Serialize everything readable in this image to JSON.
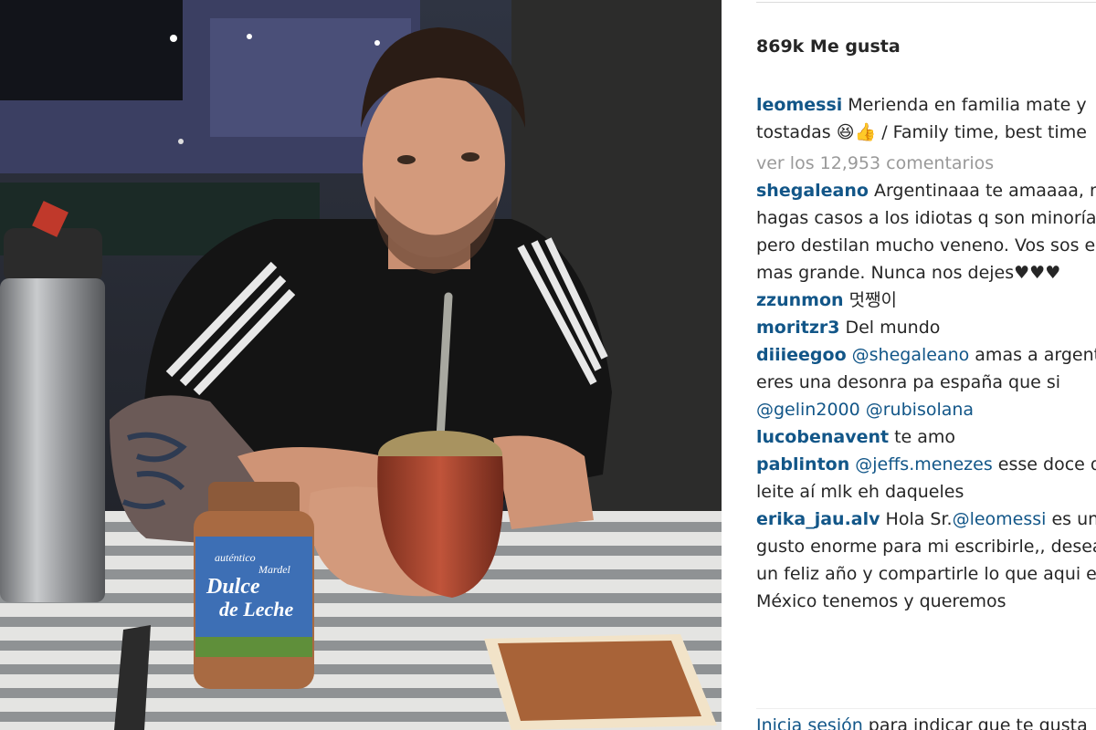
{
  "post": {
    "photo_alt": "Man at a table with a mate gourd, a thermos, a jar and toast",
    "jar": {
      "line1": "auténtico",
      "brand": "Mardel",
      "line2": "Dulce",
      "line3": "de Leche"
    },
    "likes": "869k Me gusta",
    "caption": {
      "user": "leomessi",
      "text": "Merienda en familia mate y tostadas 😆👍 / Family time, best time"
    },
    "view_all": "ver los 12,953 comentarios",
    "comments": [
      {
        "user": "shegaleano",
        "parts": [
          {
            "text": "Argentinaaa te amaaaa, no le hagas casos a los idiotas q son minoría pero destilan mucho veneno. Vos sos el mas grande. Nunca nos dejes♥♥♥"
          }
        ]
      },
      {
        "user": "zzunmon",
        "parts": [
          {
            "text": "멋쨍이"
          }
        ]
      },
      {
        "user": "moritzr3",
        "parts": [
          {
            "text": "Del mundo"
          }
        ]
      },
      {
        "user": "diiieegoo",
        "parts": [
          {
            "text": "@shegaleano",
            "mention": true
          },
          {
            "text": " amas a argentina eres una desonra pa españa que si "
          },
          {
            "text": "@gelin2000",
            "mention": true
          },
          {
            "text": " "
          },
          {
            "text": "@rubisolana",
            "mention": true
          }
        ]
      },
      {
        "user": "lucobenavent",
        "parts": [
          {
            "text": "te amo"
          }
        ]
      },
      {
        "user": "pablinton",
        "parts": [
          {
            "text": "@jeffs.menezes",
            "mention": true
          },
          {
            "text": " esse doce de leite aí mlk eh daqueles"
          }
        ]
      },
      {
        "user": "erika_jau.alv",
        "parts": [
          {
            "text": "Hola Sr."
          },
          {
            "text": "@leomessi",
            "mention": true
          },
          {
            "text": " es un gusto enorme para mi escribirle,, desearle un feliz año y compartirle lo que aqui en México tenemos y queremos"
          }
        ]
      }
    ],
    "login": {
      "link": "Inicia sesión",
      "text": " para indicar que te gusta"
    }
  },
  "colors": {
    "link": "#125688",
    "muted": "#999999",
    "text": "#262626"
  }
}
